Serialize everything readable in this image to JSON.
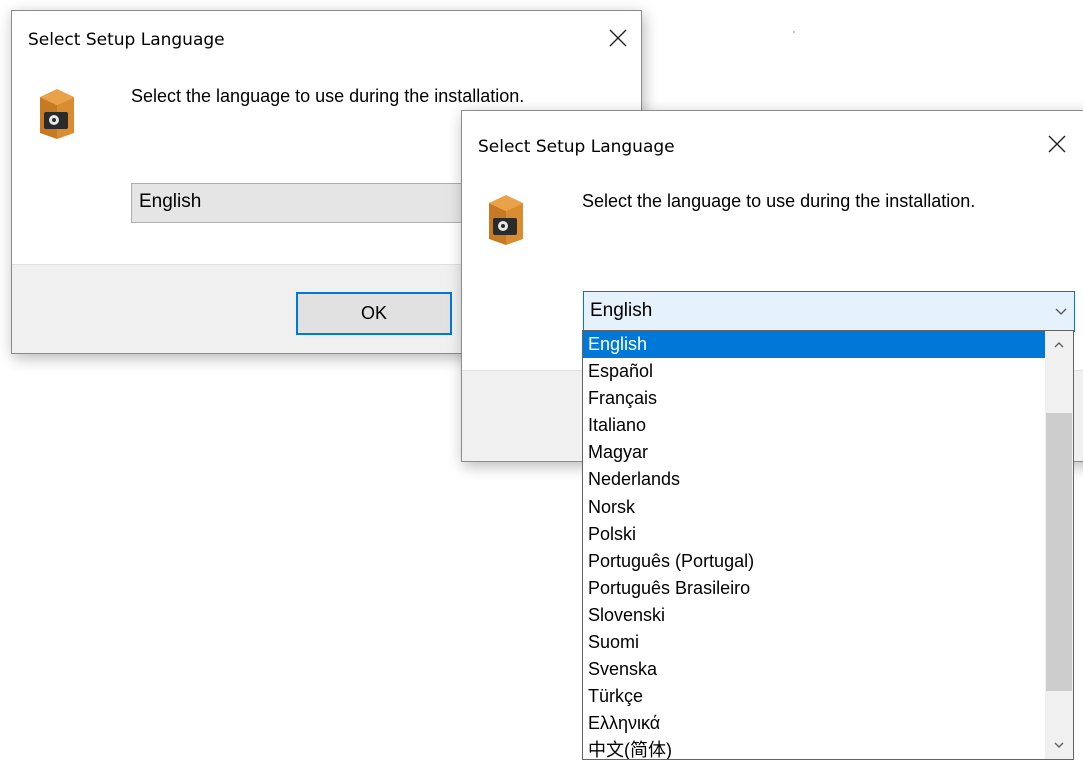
{
  "background_dialog": {
    "title": "Select Setup Language",
    "prompt": "Select the language to use during the installation.",
    "selected_language": "English",
    "ok_label": "OK",
    "icon": "setup-box-icon"
  },
  "front_dialog": {
    "title": "Select Setup Language",
    "prompt": "Select the language to use during the installation.",
    "selected_language": "English",
    "icon": "setup-box-icon"
  },
  "language_list": {
    "items": [
      "English",
      "Español",
      "Français",
      "Italiano",
      "Magyar",
      "Nederlands",
      "Norsk",
      "Polski",
      "Português (Portugal)",
      "Português Brasileiro",
      "Slovenski",
      "Suomi",
      "Svenska",
      "Türkçe",
      "Ελληνικά",
      "中文(简体)"
    ],
    "selected_index": 0
  },
  "colors": {
    "selection": "#0078d7",
    "dialog_footer": "#f0f0f0",
    "combo_focus": "#e5f1fb"
  }
}
